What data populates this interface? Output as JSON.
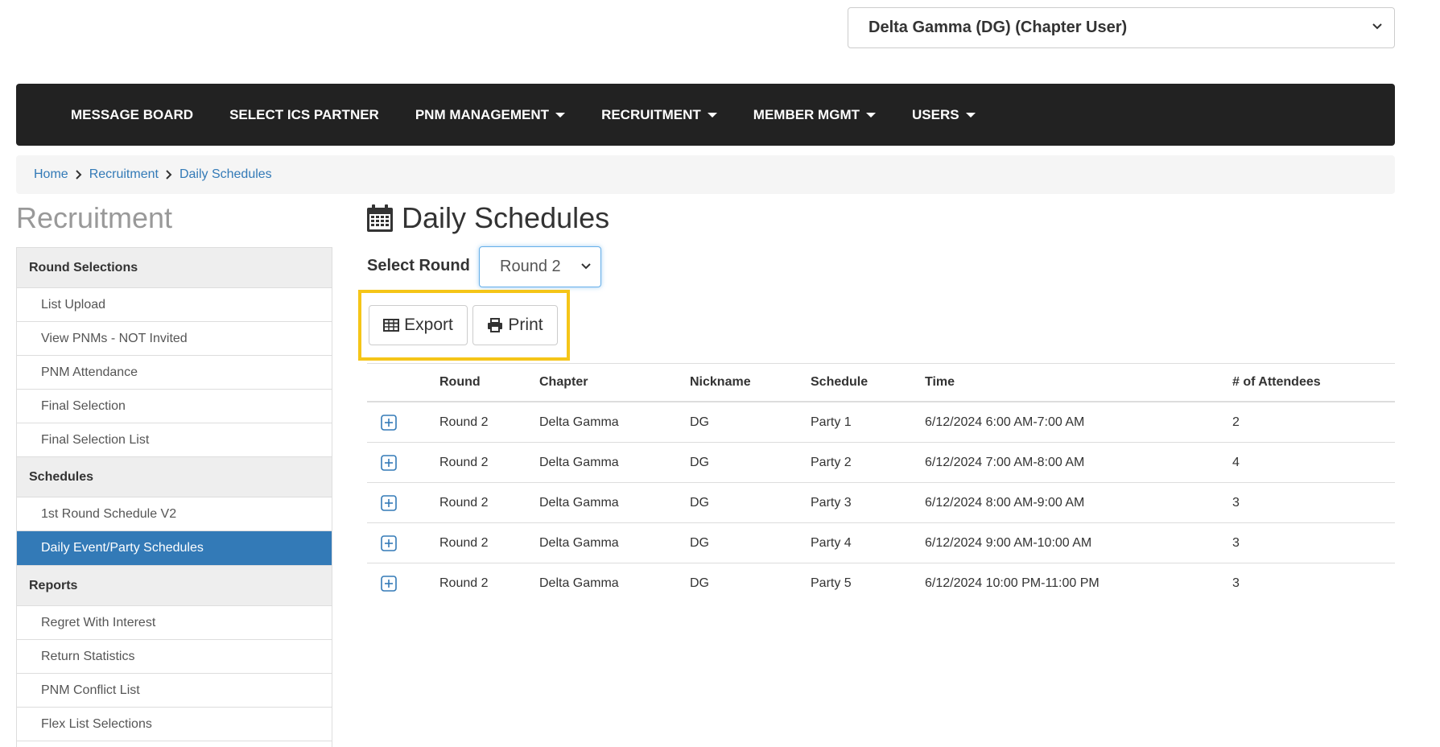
{
  "header": {
    "chapter_select": "Delta Gamma (DG) (Chapter User)"
  },
  "nav": {
    "items": [
      {
        "label": "MESSAGE BOARD",
        "dropdown": false
      },
      {
        "label": "SELECT ICS PARTNER",
        "dropdown": false
      },
      {
        "label": "PNM MANAGEMENT",
        "dropdown": true
      },
      {
        "label": "RECRUITMENT",
        "dropdown": true
      },
      {
        "label": "MEMBER MGMT",
        "dropdown": true
      },
      {
        "label": "USERS",
        "dropdown": true
      }
    ]
  },
  "breadcrumb": [
    "Home",
    "Recruitment",
    "Daily Schedules"
  ],
  "sidebar": {
    "title": "Recruitment",
    "sections": [
      {
        "header": "Round Selections",
        "items": [
          "List Upload",
          "View PNMs - NOT Invited",
          "PNM Attendance",
          "Final Selection",
          "Final Selection List"
        ]
      },
      {
        "header": "Schedules",
        "items": [
          "1st Round Schedule V2",
          "Daily Event/Party Schedules"
        ]
      },
      {
        "header": "Reports",
        "items": [
          "Regret With Interest",
          "Return Statistics",
          "PNM Conflict List",
          "Flex List Selections"
        ]
      }
    ],
    "active_item": "Daily Event/Party Schedules"
  },
  "main": {
    "title": "Daily Schedules",
    "round_label": "Select Round",
    "round_value": "Round 2",
    "export_label": "Export",
    "print_label": "Print"
  },
  "table": {
    "headers": [
      "Round",
      "Chapter",
      "Nickname",
      "Schedule",
      "Time",
      "# of Attendees"
    ],
    "rows": [
      [
        "Round 2",
        "Delta Gamma",
        "DG",
        "Party 1",
        "6/12/2024 6:00 AM-7:00 AM",
        "2"
      ],
      [
        "Round 2",
        "Delta Gamma",
        "DG",
        "Party 2",
        "6/12/2024 7:00 AM-8:00 AM",
        "4"
      ],
      [
        "Round 2",
        "Delta Gamma",
        "DG",
        "Party 3",
        "6/12/2024 8:00 AM-9:00 AM",
        "3"
      ],
      [
        "Round 2",
        "Delta Gamma",
        "DG",
        "Party 4",
        "6/12/2024 9:00 AM-10:00 AM",
        "3"
      ],
      [
        "Round 2",
        "Delta Gamma",
        "DG",
        "Party 5",
        "6/12/2024 10:00 PM-11:00 PM",
        "3"
      ]
    ]
  },
  "colors": {
    "navbar": "#222222",
    "link": "#337ab7",
    "active": "#337ab7",
    "highlight": "#f5c518"
  }
}
